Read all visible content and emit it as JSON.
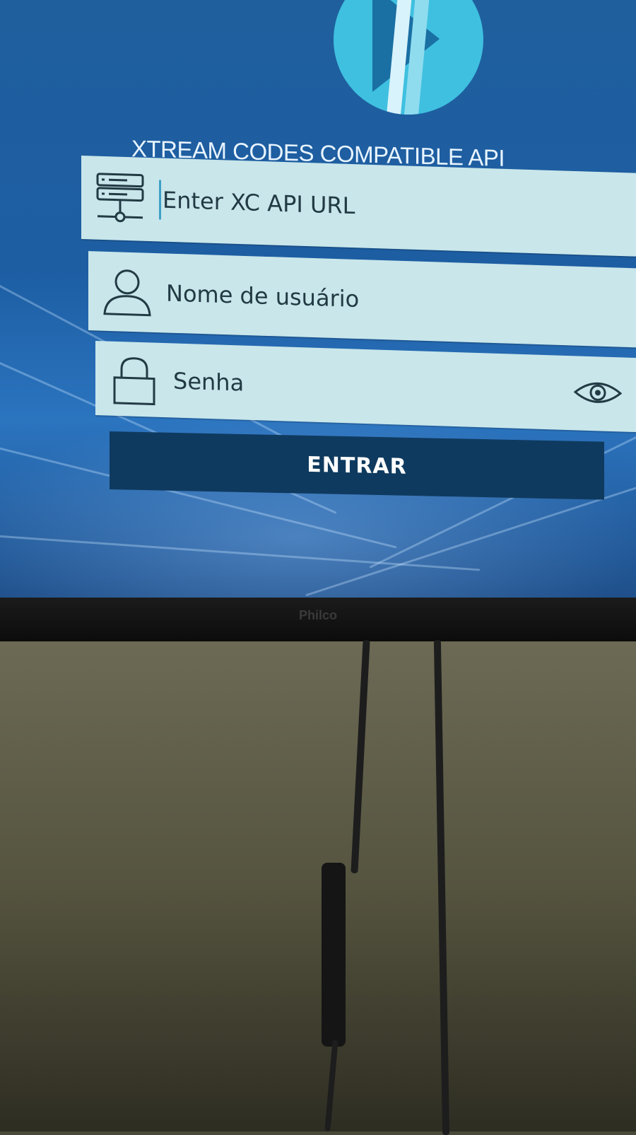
{
  "app": {
    "title": "XTREAM CODES COMPATIBLE API",
    "logo_icon": "play-logo-icon"
  },
  "form": {
    "url_field": {
      "placeholder": "Enter XC API URL",
      "icon": "server-icon"
    },
    "username_field": {
      "placeholder": "Nome de usuário",
      "icon": "user-icon"
    },
    "password_field": {
      "placeholder": "Senha",
      "icon": "lock-icon",
      "toggle_icon": "eye-icon"
    },
    "login_button": {
      "label": "ENTRAR"
    }
  },
  "device": {
    "brand": "Philco"
  },
  "colors": {
    "background": "#1f5f9e",
    "field": "#c9e6ea",
    "button": "#0f3a5f",
    "logo": "#3fc0e0"
  }
}
